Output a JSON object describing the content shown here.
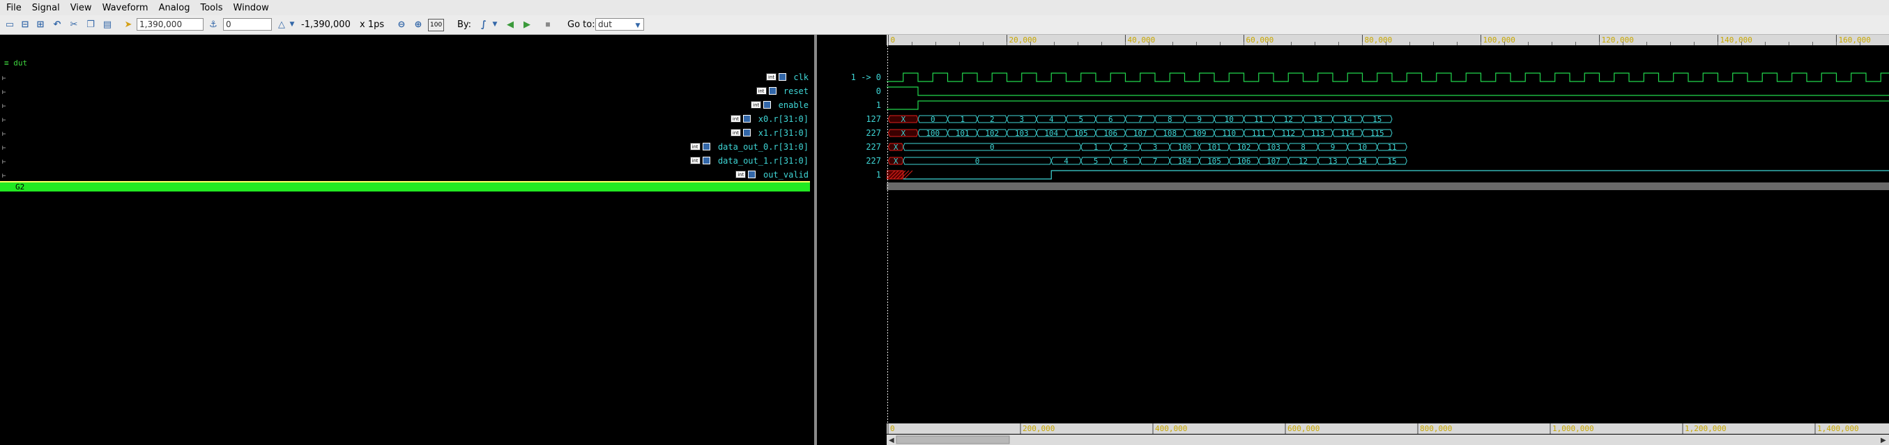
{
  "menu": [
    "File",
    "Signal",
    "View",
    "Waveform",
    "Analog",
    "Tools",
    "Window"
  ],
  "toolbar": {
    "cursor_time": "1,390,000",
    "marker_time": "0",
    "delta": "-1,390,000",
    "scale": "x 1ps",
    "by_label": "By:",
    "goto_label": "Go to:",
    "goto_value": "dut",
    "zoom_full_label": "100"
  },
  "scope": "dut",
  "signals": [
    {
      "name": "clk",
      "value": "1 -> 0"
    },
    {
      "name": "reset",
      "value": "0"
    },
    {
      "name": "enable",
      "value": "1"
    },
    {
      "name": "x0.r[31:0]",
      "value": "127"
    },
    {
      "name": "x1.r[31:0]",
      "value": "227"
    },
    {
      "name": "data_out_0.r[31:0]",
      "value": "227"
    },
    {
      "name": "data_out_1.r[31:0]",
      "value": "227"
    },
    {
      "name": "out_valid",
      "value": "1"
    }
  ],
  "group_label": "G2",
  "time_ruler": [
    "0",
    "20,000",
    "40,000",
    "60,000",
    "80,000",
    "100,000",
    "120,000",
    "140,000",
    "160,000"
  ],
  "overview_ruler": [
    "0",
    "200,000",
    "400,000",
    "600,000",
    "800,000",
    "1,000,000",
    "1,200,000",
    "1,400,000"
  ],
  "waves": {
    "x0": [
      "X",
      "0",
      "1",
      "2",
      "3",
      "4",
      "5",
      "6",
      "7",
      "8",
      "9",
      "10",
      "11",
      "12",
      "13",
      "14",
      "15"
    ],
    "x1": [
      "X",
      "100",
      "101",
      "102",
      "103",
      "104",
      "105",
      "106",
      "107",
      "108",
      "109",
      "110",
      "111",
      "112",
      "113",
      "114",
      "115"
    ],
    "data_out_0": [
      "X",
      "0",
      "1",
      "2",
      "3",
      "100",
      "101",
      "102",
      "103",
      "8",
      "9",
      "10",
      "11"
    ],
    "data_out_1": [
      "X",
      "0",
      "4",
      "5",
      "6",
      "7",
      "104",
      "105",
      "106",
      "107",
      "12",
      "13",
      "14",
      "15"
    ]
  },
  "colors": {
    "signal_text": "#3fd6d6",
    "ruler_text": "#e8d24b",
    "bus_unknown": "#e0201b",
    "group_bar": "#22e822"
  }
}
